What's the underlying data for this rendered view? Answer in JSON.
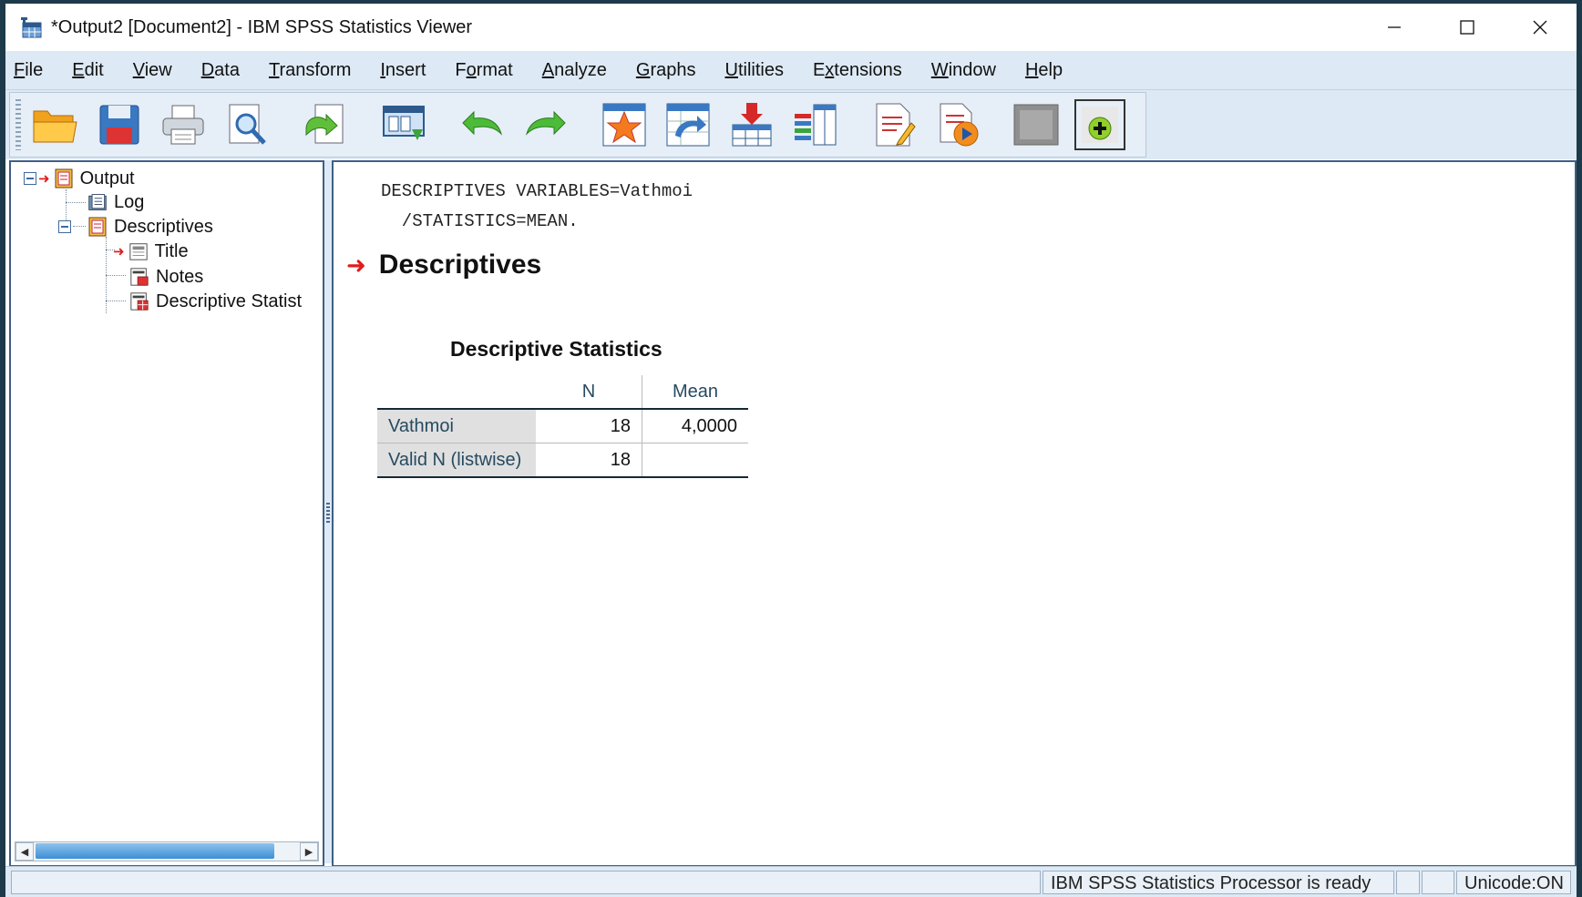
{
  "window": {
    "title": "*Output2 [Document2] - IBM SPSS Statistics Viewer"
  },
  "menu": [
    {
      "label": "File",
      "accel": "F",
      "rest": "ile"
    },
    {
      "label": "Edit",
      "accel": "E",
      "rest": "dit"
    },
    {
      "label": "View",
      "accel": "V",
      "rest": "iew"
    },
    {
      "label": "Data",
      "accel": "D",
      "rest": "ata"
    },
    {
      "label": "Transform",
      "accel": "T",
      "rest": "ransform"
    },
    {
      "label": "Insert",
      "accel": "I",
      "rest": "nsert"
    },
    {
      "label": "Format",
      "pre": "F",
      "accel": "o",
      "rest": "rmat"
    },
    {
      "label": "Analyze",
      "accel": "A",
      "rest": "nalyze"
    },
    {
      "label": "Graphs",
      "accel": "G",
      "rest": "raphs"
    },
    {
      "label": "Utilities",
      "accel": "U",
      "rest": "tilities"
    },
    {
      "label": "Extensions",
      "pre": "E",
      "accel": "x",
      "rest": "tensions"
    },
    {
      "label": "Window",
      "accel": "W",
      "rest": "indow"
    },
    {
      "label": "Help",
      "accel": "H",
      "rest": "elp"
    }
  ],
  "toolbar": [
    "open-icon",
    "save-icon",
    "print-icon",
    "print-preview-icon",
    "export-icon",
    "recall-dialog-icon",
    "undo-icon",
    "redo-icon",
    "goto-data-icon",
    "goto-case-icon",
    "insert-variable-icon",
    "select-variables-icon",
    "insert-text-icon",
    "run-script-icon",
    "designate-window-icon",
    "add-on-icon"
  ],
  "tree": {
    "root": "Output",
    "log": "Log",
    "descriptives": "Descriptives",
    "title": "Title",
    "notes": "Notes",
    "descriptive_stats": "Descriptive Statist"
  },
  "content": {
    "syntax_line1": "DESCRIPTIVES VARIABLES=Vathmoi",
    "syntax_line2": "  /STATISTICS=MEAN.",
    "heading": "Descriptives",
    "table": {
      "title": "Descriptive Statistics",
      "columns": [
        "N",
        "Mean"
      ],
      "rows": [
        {
          "label": "Vathmoi",
          "n": "18",
          "mean": "4,0000"
        },
        {
          "label": "Valid N (listwise)",
          "n": "18",
          "mean": ""
        }
      ]
    }
  },
  "status": {
    "processor": "IBM SPSS Statistics Processor is ready",
    "unicode": "Unicode:ON"
  },
  "colors": {
    "accent_red": "#e01c1c",
    "menu_bg": "#dde9f5",
    "pane_border": "#3f5f86",
    "table_header_text": "#264a60"
  }
}
